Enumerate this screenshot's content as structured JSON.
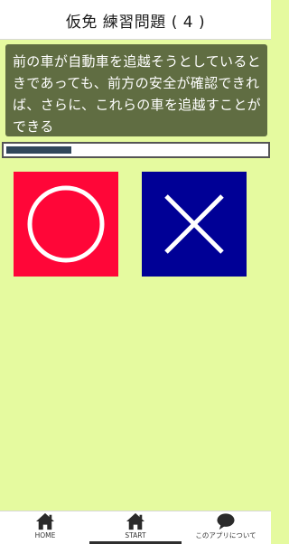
{
  "header": {
    "title": "仮免 練習問題 ( 4 )"
  },
  "question": {
    "text": "前の車が自動車を追越そうとしているときであっても、前方の安全が確認できれば、さらに、これらの車を追越すことができる"
  },
  "progress": {
    "fraction": 0.25
  },
  "answers": {
    "correct_icon": "circle-icon",
    "wrong_icon": "cross-icon",
    "correct_color": "#ff0638",
    "wrong_color": "#000096"
  },
  "bottom_nav": {
    "items": [
      {
        "label": "HOME",
        "icon": "home-icon"
      },
      {
        "label": "START",
        "icon": "home-icon"
      },
      {
        "label": "このアプリについて",
        "icon": "chat-bubble-icon"
      }
    ],
    "active_index": 1
  },
  "colors": {
    "background": "#e5fa9f",
    "question_box": "#606d42",
    "progress_fill": "#30465a"
  }
}
